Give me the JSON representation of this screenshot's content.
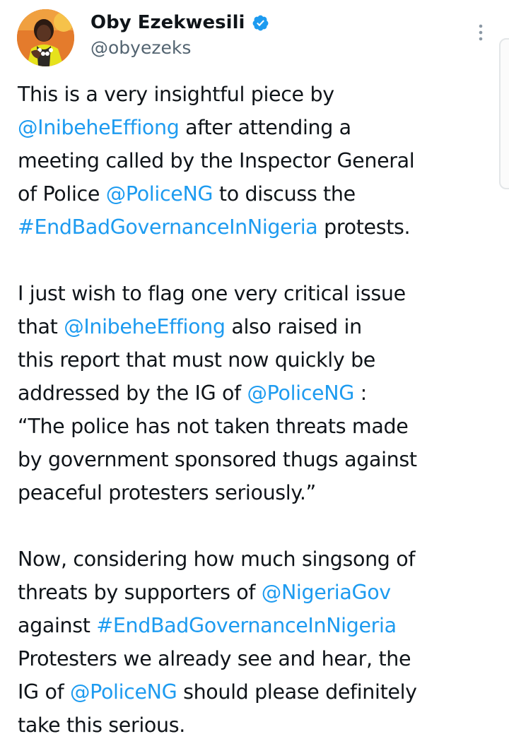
{
  "author": {
    "display_name": "Oby Ezekwesili",
    "handle": "@obyezeks",
    "verified": true,
    "avatar_icon": "profile-photo",
    "verified_icon": "verified-badge-icon",
    "more_icon": "more-options-vertical-icon"
  },
  "colors": {
    "link": "#1d9bf0",
    "text": "#0f1419",
    "secondary": "#536471"
  },
  "tweet": {
    "paragraphs": [
      [
        {
          "t": "This is a very insightful piece by\n"
        },
        {
          "t": "@InibeheEffiong",
          "link": true
        },
        {
          "t": " after attending a\nmeeting called by the Inspector General\nof Police "
        },
        {
          "t": "@PoliceNG",
          "link": true
        },
        {
          "t": " to discuss the\n"
        },
        {
          "t": "#EndBadGovernanceInNigeria",
          "link": true
        },
        {
          "t": " protests."
        }
      ],
      [
        {
          "t": "I just wish to flag one very critical issue\nthat "
        },
        {
          "t": "@InibeheEffiong",
          "link": true
        },
        {
          "t": " also raised in\nthis report that must now quickly be\naddressed by the IG of "
        },
        {
          "t": "@PoliceNG",
          "link": true
        },
        {
          "t": " :\n“The police has not taken threats made\nby government sponsored thugs against\npeaceful protesters seriously.”"
        }
      ],
      [
        {
          "t": "Now, considering how much singsong of\nthreats by supporters of "
        },
        {
          "t": "@NigeriaGov",
          "link": true
        },
        {
          "t": "\nagainst "
        },
        {
          "t": "#EndBadGovernanceInNigeria",
          "link": true
        },
        {
          "t": "\nProtesters we already see and hear, the\nIG of "
        },
        {
          "t": "@PoliceNG",
          "link": true
        },
        {
          "t": " should please definitely\ntake this serious."
        }
      ]
    ]
  }
}
